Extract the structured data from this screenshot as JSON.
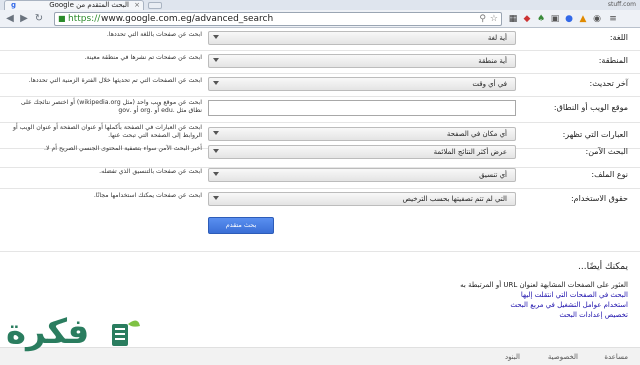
{
  "browser": {
    "tab_title": "البحث المتقدم من Google",
    "tab_icon": "g-icon",
    "user_label": "stuff.com",
    "url_scheme": "https://",
    "url_path": "www.google.com.eg/advanced_search"
  },
  "form": {
    "rows": [
      {
        "label": "اللغة:",
        "value": "أية لغة",
        "hint": "ابحث عن صفحات باللغة التي تحددها.",
        "kind": "select"
      },
      {
        "label": "المنطقة:",
        "value": "أية منطقة",
        "hint": "ابحث عن صفحات تم نشرها في منطقة معينة.",
        "kind": "select"
      },
      {
        "label": "آخر تحديث:",
        "value": "في أي وقت",
        "hint": "ابحث عن الصفحات التي تم تحديثها خلال الفترة الزمنية التي تحددها.",
        "kind": "select"
      },
      {
        "label": "موقع الويب أو النطاق:",
        "value": "",
        "hint": "ابحث عن موقع ويب واحد (مثل wikipedia.org) أو اختصر نتائجك على نطاق مثل .edu أو .org أو .gov",
        "kind": "text"
      },
      {
        "label": "العبارات التي تظهر:",
        "value": "أي مكان في الصفحة",
        "hint": "ابحث عن العبارات في الصفحة بأكملها أو عنوان الصفحة أو عنوان الويب أو الروابط إلى الصفحة التي تبحث عنها.",
        "kind": "select"
      },
      {
        "label": "البحث الآمن:",
        "value": "عرض أكثر النتائج الملائمة",
        "hint": "أخبر البحث الآمن سواء بتصفية المحتوى الجنسي الصريح أم لا.",
        "kind": "select"
      },
      {
        "label": "نوع الملف:",
        "value": "أي تنسيق",
        "hint": "ابحث عن صفحات بالتنسيق الذي تفضله.",
        "kind": "select"
      },
      {
        "label": "حقوق الاستخدام:",
        "value": "التي لم تتم تصفيتها بحسب الترخيص",
        "hint": "ابحث عن صفحات يمكنك استخدامها مجانًا.",
        "kind": "select"
      }
    ],
    "submit_label": "بحث متقدم"
  },
  "also": {
    "title": "يمكنك أيضًا...",
    "links": [
      "العثور على الصفحات المشابهة لعنوان URL أو المرتبطة به",
      "البحث في الصفحات التي انتقلت إليها",
      "استخدام عوامل التشغيل في مربع البحث",
      "تخصيص إعدادات البحث"
    ]
  },
  "footer": {
    "help": "مساعدة",
    "privacy": "الخصوصية",
    "terms": "البنود"
  },
  "watermark": {
    "text": "فكرة"
  }
}
